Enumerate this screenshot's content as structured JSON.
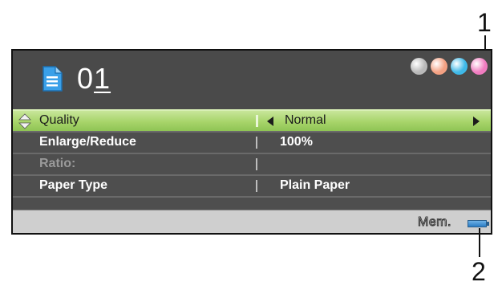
{
  "callouts": {
    "one": "1",
    "two": "2"
  },
  "screen": {
    "title": {
      "copies_first_digit": "0",
      "copies_second_digit": "1"
    },
    "ink_colors": [
      "#b9b9b9",
      "#f4a183",
      "#3fb9e8",
      "#f07cc0"
    ],
    "settings": [
      {
        "label": "Quality",
        "value": "Normal"
      },
      {
        "label": "Enlarge/Reduce",
        "value": "100%"
      },
      {
        "label": "Ratio:",
        "value": ""
      },
      {
        "label": "Paper Type",
        "value": "Plain Paper"
      }
    ],
    "status": {
      "memory_label": "Mem."
    }
  }
}
